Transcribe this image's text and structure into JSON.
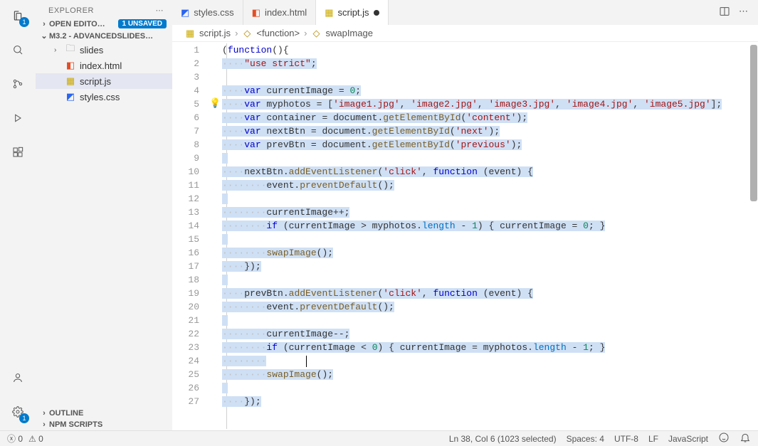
{
  "sidebar": {
    "title": "EXPLORER",
    "openEditors": "OPEN EDITO…",
    "unsaved": "1 UNSAVED",
    "folder": "M3.2 - ADVANCEDSLIDES…",
    "items": {
      "slides": "slides",
      "index": "index.html",
      "script": "script.js",
      "styles": "styles.css"
    },
    "outline": "OUTLINE",
    "npm": "NPM SCRIPTS"
  },
  "tabs": {
    "css": "styles.css",
    "html": "index.html",
    "js": "script.js"
  },
  "breadcrumb": {
    "file": "script.js",
    "fn": "<function>",
    "swap": "swapImage"
  },
  "code": {
    "l1a": "(",
    "l1b": "function",
    "l1c": "(){",
    "l2a": "\"use strict\"",
    "l2b": ";",
    "l4a": "var",
    "l4b": " currentImage ",
    "l4c": "=",
    "l4d": "0",
    "l4e": ";",
    "l5a": "var",
    "l5b": " myphotos ",
    "l5c": "=",
    "l5d": " [",
    "l5e": "'image1.jpg'",
    "l5f": ", ",
    "l5g": "'image2.jpg'",
    "l5h": "'image3.jpg'",
    "l5i": "'image4.jpg'",
    "l5j": "'image5.jpg'",
    "l5k": "];",
    "l6a": "var",
    "l6b": " container ",
    "l6c": "=",
    "l6d": " document.",
    "l6e": "getElementById",
    "l6f": "(",
    "l6g": "'content'",
    "l6h": ");",
    "l7a": "var",
    "l7b": " nextBtn ",
    "l7c": "=",
    "l7d": " document.",
    "l7e": "getElementById",
    "l7g": "'next'",
    "l8a": "var",
    "l8b": " prevBtn ",
    "l8g": "'previous'",
    "l10a": "nextBtn.",
    "l10b": "addEventListener",
    "l10c": "(",
    "l10d": "'click'",
    "l10e": ", ",
    "l10f": "function",
    "l10g": " (event) {",
    "l11a": "event.",
    "l11b": "preventDefault",
    "l11c": "();",
    "l13a": "currentImage",
    "l13b": "++",
    "l13c": ";",
    "l14a": "if",
    "l14b": " (currentImage ",
    "l14c": ">",
    "l14d": " myphotos.",
    "l14e": "length",
    "l14f": " - ",
    "l14g": "1",
    "l14h": ") { currentImage ",
    "l14i": "=",
    "l14j": "0",
    "l14k": "; }",
    "l16a": "swapImage",
    "l16b": "();",
    "l17a": "});",
    "l19a": "prevBtn.",
    "l22a": "currentImage",
    "l22b": "--",
    "l23c": "<",
    "l23j": "0",
    "l23h": ") { currentImage ",
    "l23d": " myphotos.",
    "l23g": "1",
    "l23k": "; }",
    "l25a": "swapImage"
  },
  "status": {
    "err": "0",
    "warn": "0",
    "pos": "Ln 38, Col 6 (1023 selected)",
    "spaces": "Spaces: 4",
    "enc": "UTF-8",
    "eol": "LF",
    "lang": "JavaScript"
  },
  "activity_badge": "1"
}
